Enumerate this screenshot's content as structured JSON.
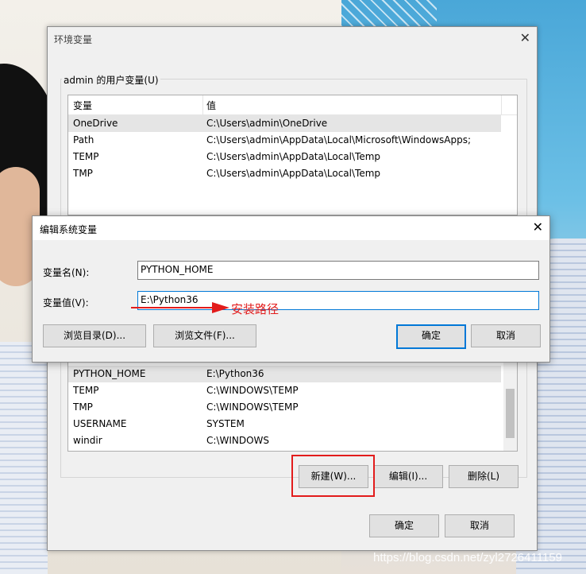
{
  "env_dialog": {
    "title": "环境变量",
    "user_group_label": "admin 的用户变量(U)",
    "user_vars": {
      "columns": [
        "变量",
        "值"
      ],
      "rows": [
        {
          "name": "OneDrive",
          "value": "C:\\Users\\admin\\OneDrive"
        },
        {
          "name": "Path",
          "value": "C:\\Users\\admin\\AppData\\Local\\Microsoft\\WindowsApps;"
        },
        {
          "name": "TEMP",
          "value": "C:\\Users\\admin\\AppData\\Local\\Temp"
        },
        {
          "name": "TMP",
          "value": "C:\\Users\\admin\\AppData\\Local\\Temp"
        }
      ]
    },
    "system_vars": {
      "rows": [
        {
          "name": "PYTHON_HOME",
          "value": "E:\\Python36"
        },
        {
          "name": "TEMP",
          "value": "C:\\WINDOWS\\TEMP"
        },
        {
          "name": "TMP",
          "value": "C:\\WINDOWS\\TEMP"
        },
        {
          "name": "USERNAME",
          "value": "SYSTEM"
        },
        {
          "name": "windir",
          "value": "C:\\WINDOWS"
        }
      ]
    },
    "buttons": {
      "new": "新建(W)...",
      "edit": "编辑(I)...",
      "delete": "删除(L)",
      "ok": "确定",
      "cancel": "取消"
    }
  },
  "edit_dialog": {
    "title": "编辑系统变量",
    "name_label": "变量名(N):",
    "name_value": "PYTHON_HOME",
    "value_label": "变量值(V):",
    "value_value": "E:\\Python36",
    "buttons": {
      "browse_dir": "浏览目录(D)...",
      "browse_file": "浏览文件(F)...",
      "ok": "确定",
      "cancel": "取消"
    }
  },
  "annotation": {
    "text": "安装路径",
    "color": "#e21c1c"
  },
  "watermark": "https://blog.csdn.net/zyl2726411159",
  "colors": {
    "dialog_bg": "#f0f0f0",
    "focus": "#0078d7",
    "selection": "#e5e5e5"
  },
  "icons": [
    "close-icon",
    "arrow-icon"
  ]
}
